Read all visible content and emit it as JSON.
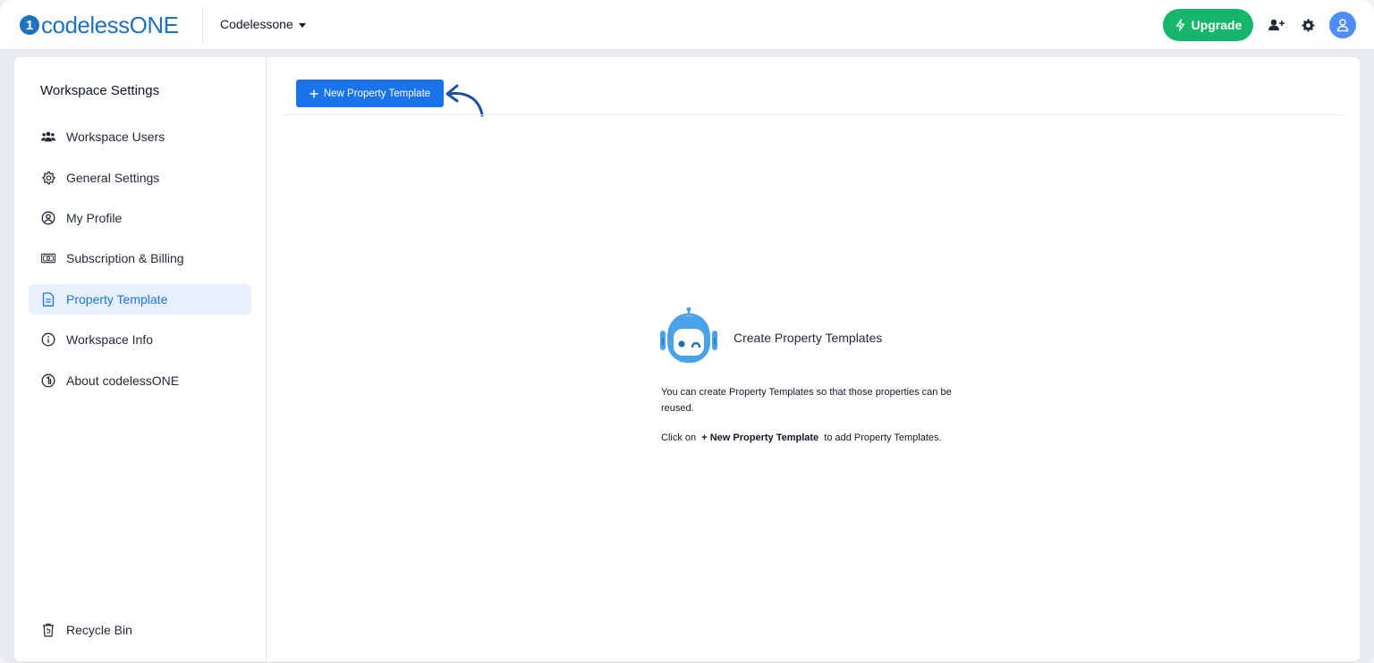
{
  "header": {
    "logo_mark": "1",
    "logo_text": "codelessONE",
    "workspace_name": "Codelessone",
    "upgrade_label": "Upgrade",
    "accent": "#1a73e8",
    "upgrade_color": "#16b66a"
  },
  "sidebar": {
    "title": "Workspace Settings",
    "items": [
      {
        "label": "Workspace Users",
        "icon": "users-icon"
      },
      {
        "label": "General Settings",
        "icon": "gear-icon"
      },
      {
        "label": "My Profile",
        "icon": "profile-icon"
      },
      {
        "label": "Subscription & Billing",
        "icon": "billing-icon"
      },
      {
        "label": "Property Template",
        "icon": "document-icon",
        "active": true
      },
      {
        "label": "Workspace Info",
        "icon": "info-icon"
      },
      {
        "label": "About codelessONE",
        "icon": "codelessone-icon"
      }
    ],
    "recycle_bin": "Recycle Bin"
  },
  "main": {
    "new_button_label": "New Property Template",
    "empty_state": {
      "title": "Create Property Templates",
      "description": "You can create Property Templates so that those properties can be reused.",
      "hint_prefix": "Click on",
      "hint_action": "+ New Property Template",
      "hint_suffix": "to add Property Templates."
    }
  }
}
